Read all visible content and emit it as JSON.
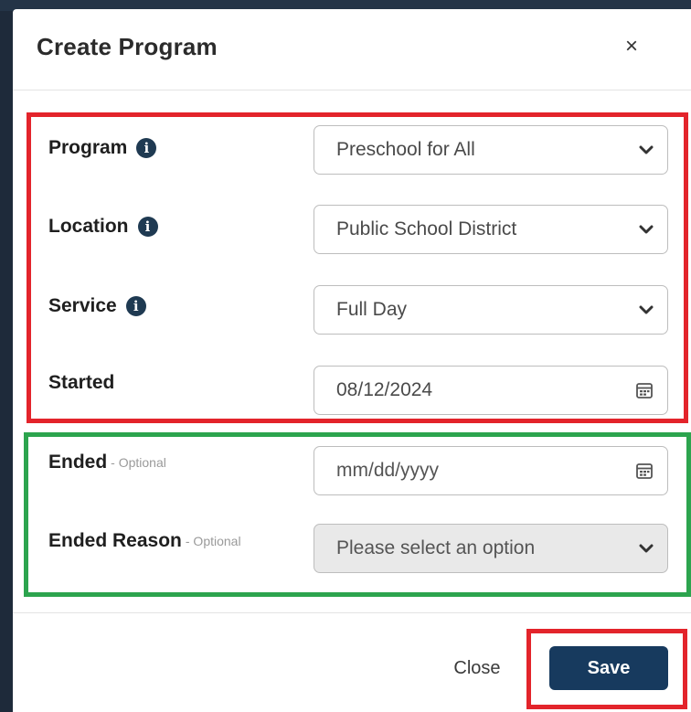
{
  "modal": {
    "title": "Create Program",
    "close_symbol": "×"
  },
  "fields": {
    "program": {
      "label": "Program",
      "value": "Preschool for All",
      "icon": "info-icon"
    },
    "location": {
      "label": "Location",
      "value": "Public School District",
      "icon": "info-icon"
    },
    "service": {
      "label": "Service",
      "value": "Full Day",
      "icon": "info-icon"
    },
    "started": {
      "label": "Started",
      "value": "08/12/2024",
      "icon": "calendar-icon"
    },
    "ended": {
      "label": "Ended",
      "optional": "- Optional",
      "placeholder": "mm/dd/yyyy",
      "icon": "calendar-icon"
    },
    "ended_reason": {
      "label": "Ended Reason",
      "optional": "- Optional",
      "placeholder": "Please select an option"
    }
  },
  "footer": {
    "close_label": "Close",
    "save_label": "Save"
  },
  "colors": {
    "primary": "#173a5e",
    "highlight_red": "#e3242b",
    "highlight_green": "#2ca44e",
    "info_icon": "#1f3a52"
  }
}
